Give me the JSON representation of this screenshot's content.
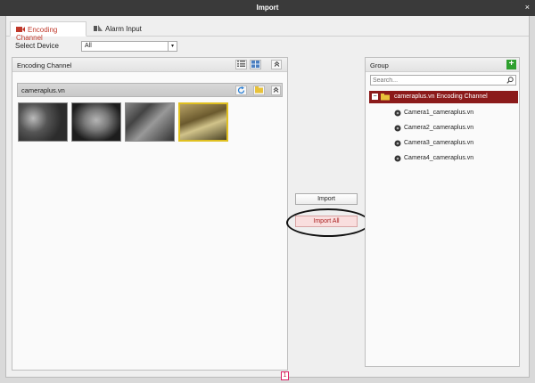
{
  "window": {
    "title": "Import",
    "close": "×"
  },
  "tabs": [
    {
      "label": "Encoding Channel",
      "active": true
    },
    {
      "label": "Alarm Input",
      "active": false
    }
  ],
  "select_device": {
    "label": "Select Device",
    "value": "All"
  },
  "left_panel": {
    "title": "Encoding Channel",
    "device": {
      "name": "cameraplus.vn"
    },
    "page": "1"
  },
  "actions": {
    "import": "Import",
    "import_all": "Import All"
  },
  "group_panel": {
    "title": "Group",
    "search_placeholder": "Search...",
    "root": "cameraplus.vn Encoding Channel",
    "cameras": [
      "Camera1_cameraplus.vn",
      "Camera2_cameraplus.vn",
      "Camera3_cameraplus.vn",
      "Camera4_cameraplus.vn"
    ]
  },
  "colors": {
    "accent": "#c0392b",
    "selected_row": "#8b1a1a",
    "add": "#2ea02e"
  }
}
